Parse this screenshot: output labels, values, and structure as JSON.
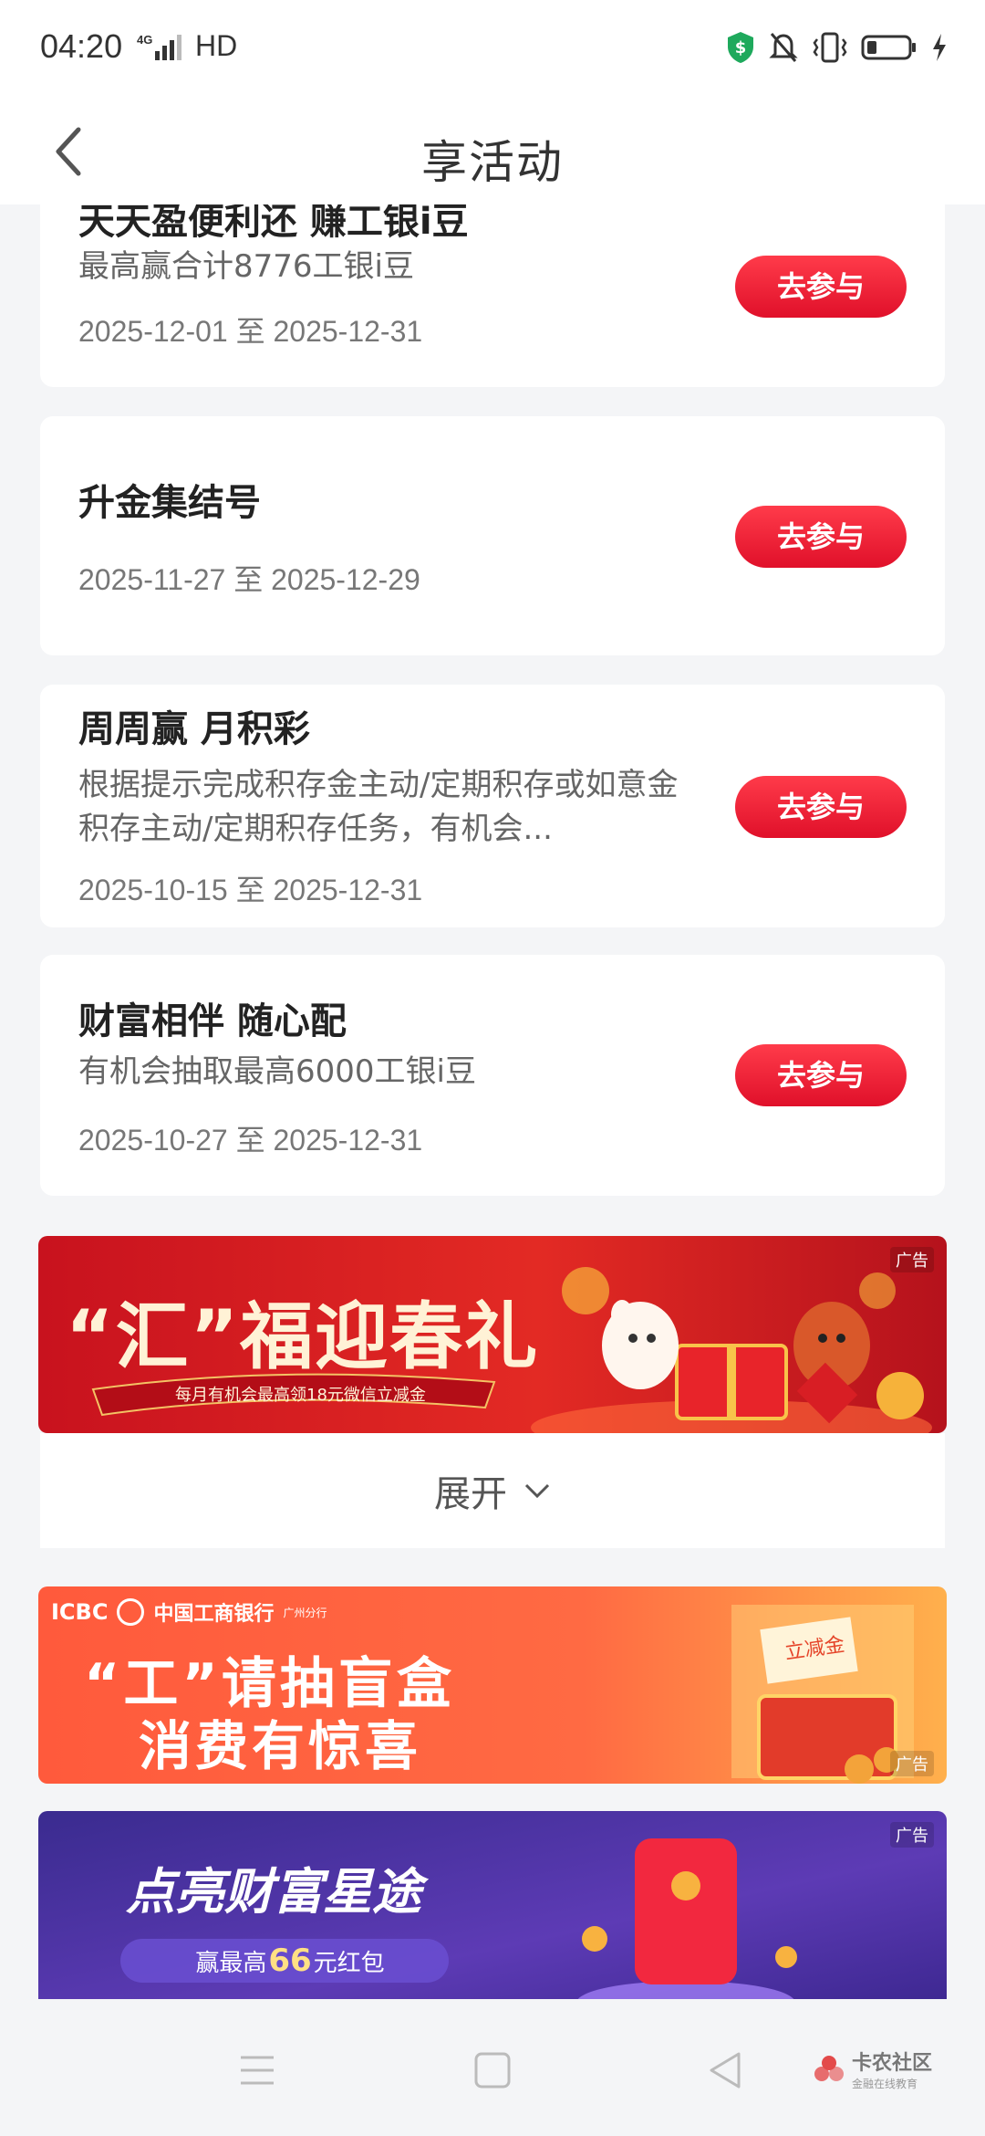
{
  "status": {
    "time": "04:20",
    "network": "4G",
    "hd": "HD"
  },
  "header": {
    "title": "享活动"
  },
  "activities": [
    {
      "title": "天天盈便利还 赚工银i豆",
      "desc": "最高赢合计8776工银i豆",
      "date": "2025-12-01 至 2025-12-31",
      "button": "去参与"
    },
    {
      "title": "升金集结号",
      "desc": "",
      "date": "2025-11-27 至 2025-12-29",
      "button": "去参与"
    },
    {
      "title": "周周赢 月积彩",
      "desc": "根据提示完成积存金主动/定期积存或如意金积存主动/定期积存任务，有机会...",
      "date": "2025-10-15 至 2025-12-31",
      "button": "去参与"
    },
    {
      "title": "财富相伴 随心配",
      "desc": "有机会抽取最高6000工银i豆",
      "date": "2025-10-27 至 2025-12-31",
      "button": "去参与"
    }
  ],
  "banners": [
    {
      "title": "“汇”福迎春礼",
      "subtitle": "每月有机会最高领18元微信立减金",
      "ad": "广告"
    },
    {
      "brand": "ICBC",
      "bank": "中国工商银行",
      "branch": "广州分行",
      "line1": "“工”请抽盲盒",
      "line2": "消费有惊喜",
      "tag": "立减金",
      "ad": "广告"
    },
    {
      "title": "点亮财富星途",
      "subtitle_prefix": "赢最高",
      "subtitle_amount": "66",
      "subtitle_suffix": "元红包",
      "ad": "广告"
    }
  ],
  "expand_label": "展开",
  "watermark": {
    "main": "卡农社区",
    "sub": "金融在线教育"
  },
  "colors": {
    "accent": "#e8142c",
    "background": "#f4f5f7"
  }
}
